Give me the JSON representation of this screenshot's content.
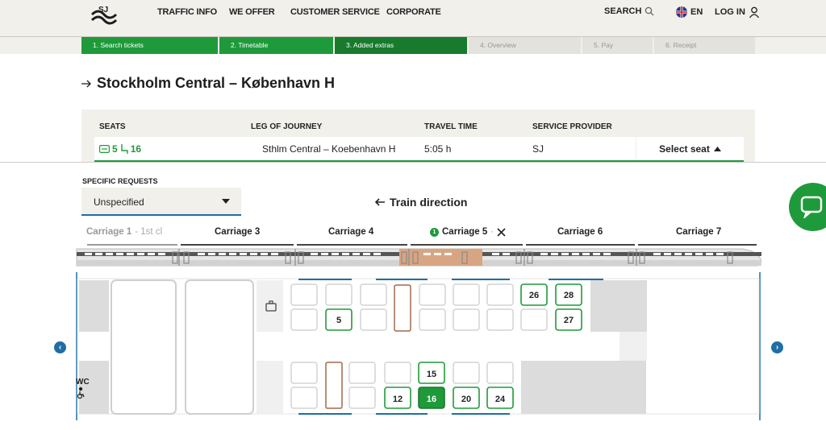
{
  "header": {
    "nav": [
      "TRAFFIC INFO",
      "WE OFFER",
      "CUSTOMER SERVICE",
      "CORPORATE"
    ],
    "search_label": "SEARCH",
    "language": "EN",
    "login_label": "LOG IN"
  },
  "progress": {
    "steps": [
      "1. Search tickets",
      "2. Timetable",
      "3. Added extras",
      "4. Overview",
      "5. Pay",
      "6. Receipt"
    ]
  },
  "route": {
    "title": "Stockholm Central – København H"
  },
  "summary": {
    "headers": [
      "SEATS",
      "LEG OF JOURNEY",
      "TRAVEL TIME",
      "SERVICE PROVIDER"
    ],
    "seats": "5 16",
    "seat_a": "5",
    "seat_b": "16",
    "leg": "Sthlm Central – Koebenhavn H",
    "travel_time": "5:05 h",
    "provider": "SJ",
    "select_seat_label": "Select seat"
  },
  "requests": {
    "label": "SPECIFIC REQUESTS",
    "value": "Unspecified"
  },
  "train_direction": "Train direction",
  "carriages": [
    {
      "label": "Carriage 1",
      "sub": "- 1st cl"
    },
    {
      "label": "Carriage 3"
    },
    {
      "label": "Carriage 4"
    },
    {
      "label": "Carriage 5",
      "badge": "1"
    },
    {
      "label": "Carriage 6"
    },
    {
      "label": "Carriage 7"
    }
  ],
  "seat_map": {
    "wc_label": "WC",
    "seats_top": [
      "5",
      "26",
      "28",
      "27"
    ],
    "seats_bottom": [
      "15",
      "12",
      "16",
      "20",
      "24"
    ],
    "selected": [
      "5",
      "16"
    ]
  },
  "colors": {
    "brand_green": "#1f9a3a",
    "accent_blue": "#1d6fa5",
    "header_bg": "#f1f0eb"
  }
}
